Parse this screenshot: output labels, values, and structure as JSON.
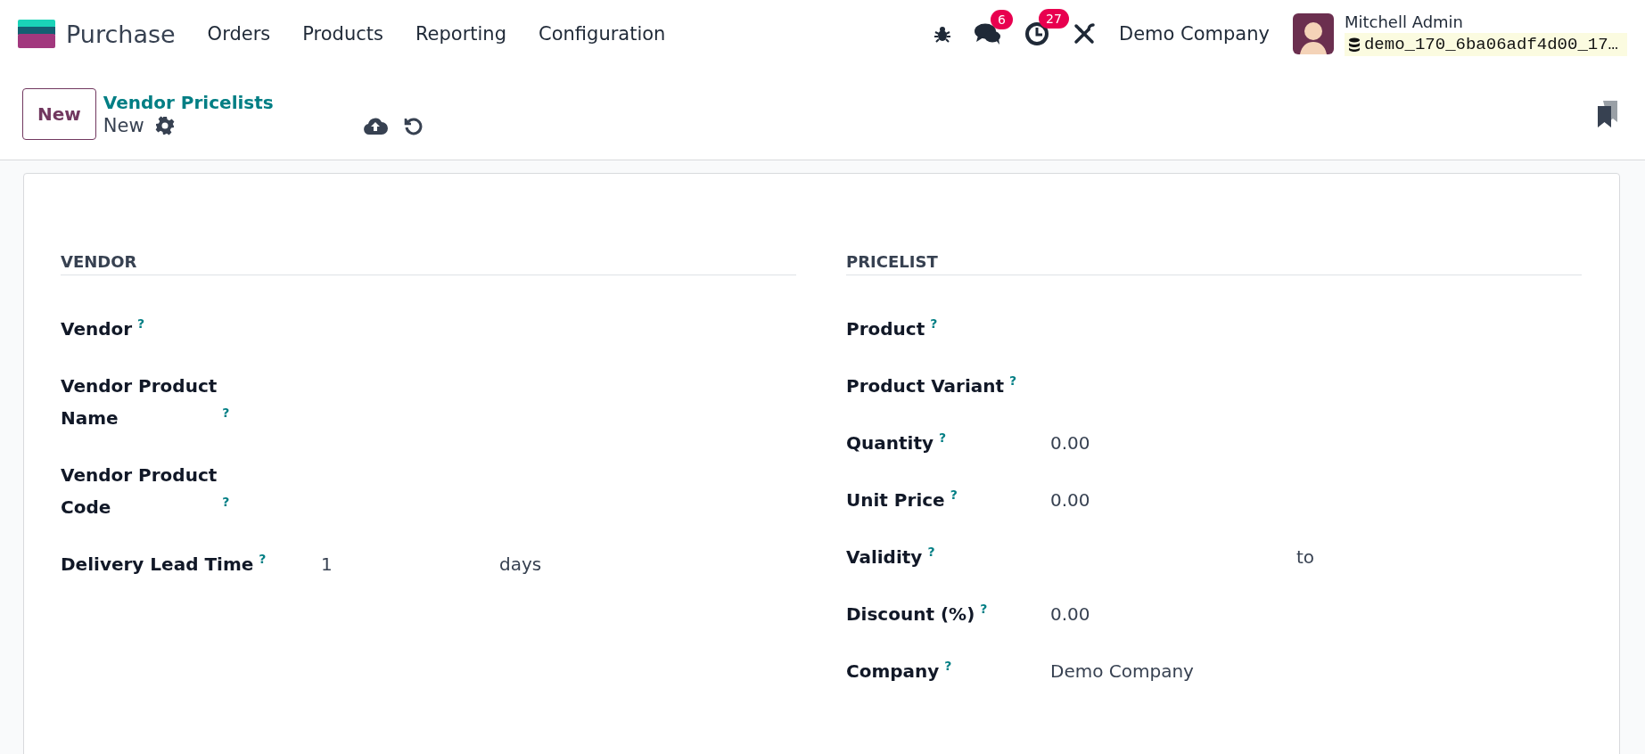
{
  "app": {
    "name": "Purchase"
  },
  "menu": [
    "Orders",
    "Products",
    "Reporting",
    "Configuration"
  ],
  "systray": {
    "messages_badge": "6",
    "activities_badge": "27",
    "company": "Demo Company",
    "user": "Mitchell Admin",
    "database": "demo_170_6ba06adf4d00_17…"
  },
  "control_panel": {
    "new_button": "New",
    "breadcrumb": "Vendor Pricelists",
    "record": "New"
  },
  "sections": [
    {
      "title": "VENDOR",
      "fields": [
        {
          "kind": "empty",
          "label": "Vendor",
          "help": "?"
        },
        {
          "kind": "empty",
          "label": "Vendor Product\nName",
          "help": "?"
        },
        {
          "kind": "empty",
          "label": "Vendor Product\nCode",
          "help": "?"
        },
        {
          "kind": "unit",
          "label": "Delivery Lead Time",
          "help": "?",
          "value": "1",
          "unit": "days"
        }
      ]
    },
    {
      "title": "PRICELIST",
      "fields": [
        {
          "kind": "empty",
          "label": "Product",
          "help": "?"
        },
        {
          "kind": "empty",
          "label": "Product Variant",
          "help": "?"
        },
        {
          "kind": "value",
          "label": "Quantity",
          "help": "?",
          "value": "0.00"
        },
        {
          "kind": "value",
          "label": "Unit Price",
          "help": "?",
          "value": "0.00"
        },
        {
          "kind": "range",
          "label": "Validity",
          "help": "?",
          "separator": "to"
        },
        {
          "kind": "value",
          "label": "Discount (%)",
          "help": "?",
          "value": "0.00"
        },
        {
          "kind": "value",
          "label": "Company",
          "help": "?",
          "value": "Demo Company"
        }
      ]
    }
  ]
}
